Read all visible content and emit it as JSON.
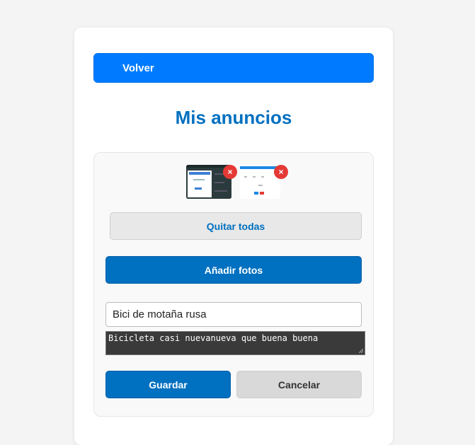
{
  "header": {
    "back_label": "Volver"
  },
  "page": {
    "title": "Mis anuncios"
  },
  "photos": {
    "remove_icon": "×",
    "remove_all_label": "Quitar todas",
    "add_label": "Añadir fotos"
  },
  "form": {
    "title_value": "Bici de motaña rusa",
    "description_value": "Bicicleta casi nuevanueva que buena buena",
    "save_label": "Guardar",
    "cancel_label": "Cancelar"
  },
  "colors": {
    "primary": "#0070c0",
    "back_button": "#007bff",
    "remove": "#e53935",
    "neutral": "#d9d9d9"
  }
}
